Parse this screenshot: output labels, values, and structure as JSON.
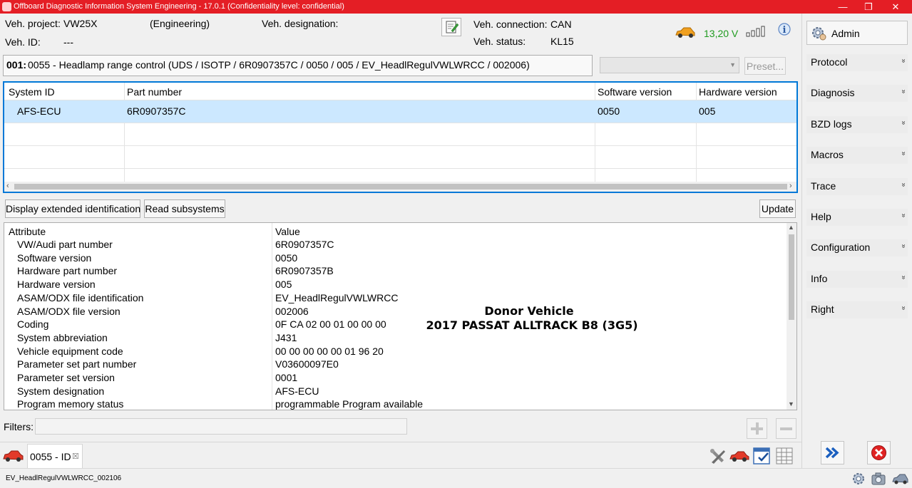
{
  "window": {
    "title": "Offboard Diagnostic Information System Engineering - 17.0.1 (Confidentiality level: confidential)",
    "minimize": "—",
    "maximize": "❐",
    "close": "✕"
  },
  "header": {
    "veh_project_label": "Veh. project:",
    "veh_project_value": "VW25X",
    "mode": "(Engineering)",
    "veh_designation_label": "Veh. designation:",
    "veh_id_label": "Veh. ID:",
    "veh_id_value": "---",
    "veh_connection_label": "Veh. connection:",
    "veh_connection_value": "CAN",
    "veh_status_label": "Veh. status:",
    "veh_status_value": "KL15",
    "voltage": "13,20 V",
    "voltage_color": "#1f9b1f"
  },
  "user": {
    "name": "Admin"
  },
  "ecu_bar": {
    "prefix": "001:",
    "text": "0055 - Headlamp range control  (UDS / ISOTP / 6R0907357C / 0050 / 005 / EV_HeadlRegulVWLWRCC / 002006)",
    "preset_label": "Preset..."
  },
  "sys_table": {
    "headers": [
      "System ID",
      "Part number",
      "Software version",
      "Hardware version"
    ],
    "rows": [
      [
        "AFS-ECU",
        "6R0907357C",
        "0050",
        "005"
      ]
    ],
    "selected_color": "#cce8ff"
  },
  "actions": {
    "extended": "Display extended identification",
    "subsystems": "Read subsystems",
    "update": "Update"
  },
  "attr_table": {
    "headers": [
      "Attribute",
      "Value"
    ],
    "rows": [
      [
        "VW/Audi part number",
        "6R0907357C"
      ],
      [
        "Software version",
        "0050"
      ],
      [
        "Hardware part number",
        "6R0907357B"
      ],
      [
        "Hardware version",
        "005"
      ],
      [
        "ASAM/ODX file identification",
        "EV_HeadlRegulVWLWRCC"
      ],
      [
        "ASAM/ODX file version",
        "002006"
      ],
      [
        "Coding",
        "0F CA 02 00 01 00 00 00"
      ],
      [
        "System abbreviation",
        "J431"
      ],
      [
        "Vehicle equipment code",
        "00 00 00 00 00 01 96 20"
      ],
      [
        "Parameter set part number",
        "V03600097E0"
      ],
      [
        "Parameter set version",
        "0001"
      ],
      [
        "System designation",
        "AFS-ECU"
      ],
      [
        "Program memory status",
        "programmable Program available"
      ]
    ]
  },
  "watermark": {
    "line1": "Donor Vehicle",
    "line2": "2017 PASSAT ALLTRACK B8 (3G5)"
  },
  "filters": {
    "label": "Filters:"
  },
  "tab": {
    "label": "0055 - ID",
    "close": "☒"
  },
  "side_menu": [
    "Protocol",
    "Diagnosis",
    "BZD logs",
    "Macros",
    "Trace",
    "Help",
    "Configuration",
    "Info",
    "Right"
  ],
  "status": {
    "text": "EV_HeadlRegulVWLWRCC_002106"
  },
  "colors": {
    "accent_red": "#e41e25",
    "selection_blue": "#0078d7"
  }
}
